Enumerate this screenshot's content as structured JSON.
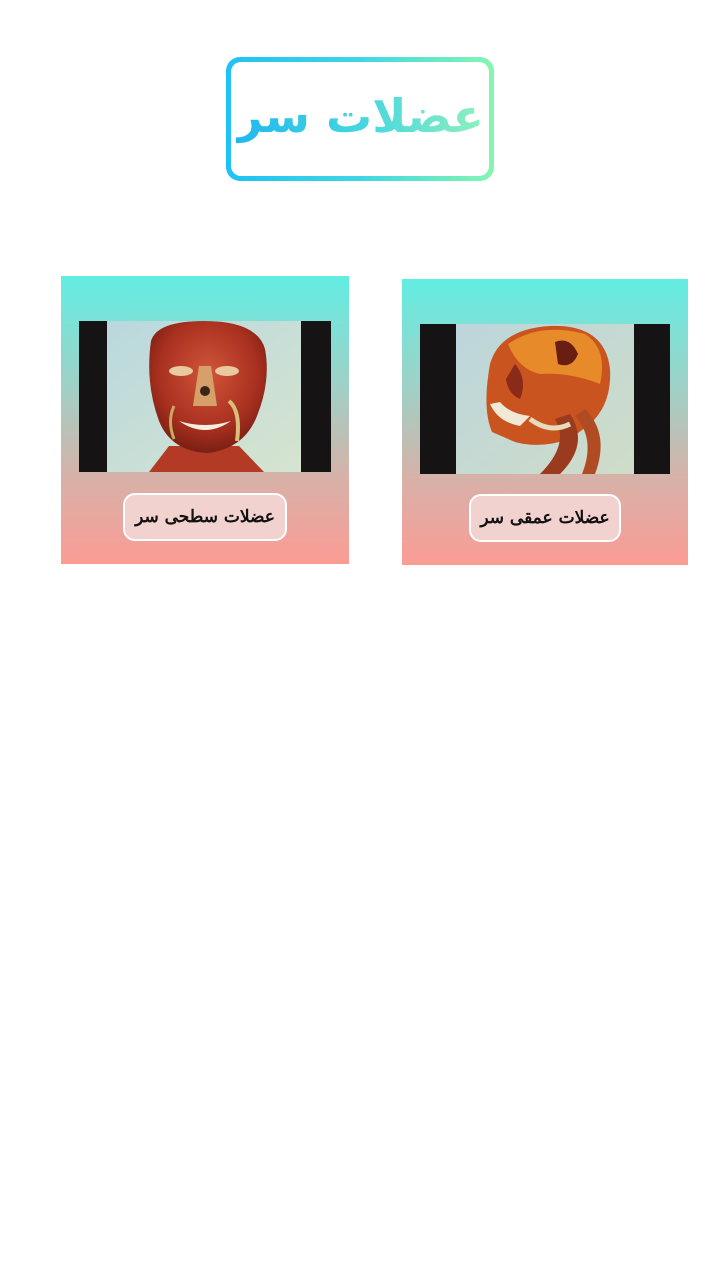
{
  "header": {
    "title": "عضلات سر"
  },
  "cards": [
    {
      "label": "عضلات سطحی سر",
      "image": "superficial-head-muscles-illustration"
    },
    {
      "label": "عضلات عمقی سر",
      "image": "deep-head-muscles-illustration"
    }
  ],
  "colors": {
    "title_gradient_start": "#1fc1f5",
    "title_gradient_end": "#86f5b0",
    "card_gradient_top": "#62ede2",
    "card_gradient_bottom": "#fb9c94",
    "label_background": "#f2d2cf"
  }
}
